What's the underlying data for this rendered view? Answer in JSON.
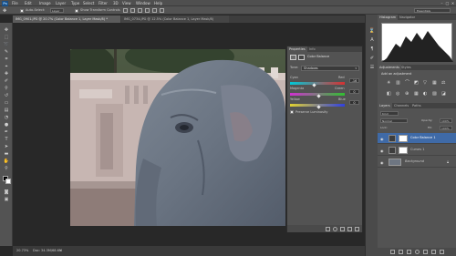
{
  "app": {
    "logo": "Ps"
  },
  "menu": {
    "items": [
      "File",
      "Edit",
      "Image",
      "Layer",
      "Type",
      "Select",
      "Filter",
      "3D",
      "View",
      "Window",
      "Help"
    ]
  },
  "window_controls": {
    "minimize": "–",
    "maximize": "□",
    "close": "✕"
  },
  "options_bar": {
    "auto_select_label": "Auto-Select:",
    "auto_select_value": "Layer",
    "transform_label": "Show Transform Controls",
    "workspace": "Essentials"
  },
  "tabs": [
    {
      "label": "IMG_0901.JPG @ 20.7% (Color Balance 1, Layer Mask/8) *",
      "active": true
    },
    {
      "label": "IMG_0734.JPG @ 12.5% (Color Balance 1, Layer Mask/8)",
      "active": false
    }
  ],
  "status": {
    "zoom": "20.73%",
    "doc": "Doc: 34.3M/68.6M"
  },
  "properties": {
    "tabs": [
      "Properties",
      "Info"
    ],
    "adjustment_title": "Color Balance",
    "tone_label": "Tone:",
    "tone_value": "Shadows",
    "sliders": [
      {
        "left": "Cyan",
        "right": "Red",
        "value": "-16",
        "position": 0.41
      },
      {
        "left": "Magenta",
        "right": "Green",
        "value": "0",
        "position": 0.5
      },
      {
        "left": "Yellow",
        "right": "Blue",
        "value": "0",
        "position": 0.5
      }
    ],
    "preserve_label": "Preserve Luminosity"
  },
  "histogram": {
    "tabs": [
      "Histogram",
      "Navigator"
    ]
  },
  "adjustments": {
    "tabs": [
      "Adjustments",
      "Styles"
    ],
    "title": "Add an adjustment"
  },
  "layers": {
    "tabs": [
      "Layers",
      "Channels",
      "Paths"
    ],
    "kind_label": "Kind",
    "blend_mode": "Normal",
    "opacity_label": "Opacity:",
    "opacity_value": "100%",
    "lock_label": "Lock:",
    "fill_label": "Fill:",
    "fill_value": "100%",
    "rows": [
      {
        "name": "Color Balance 1",
        "selected": true
      },
      {
        "name": "Curves 1",
        "selected": false
      },
      {
        "name": "Background",
        "selected": false
      }
    ]
  },
  "colors": {
    "accent": "#3f6aa7",
    "panel": "#535353",
    "menubar": "#4f4f4f"
  }
}
